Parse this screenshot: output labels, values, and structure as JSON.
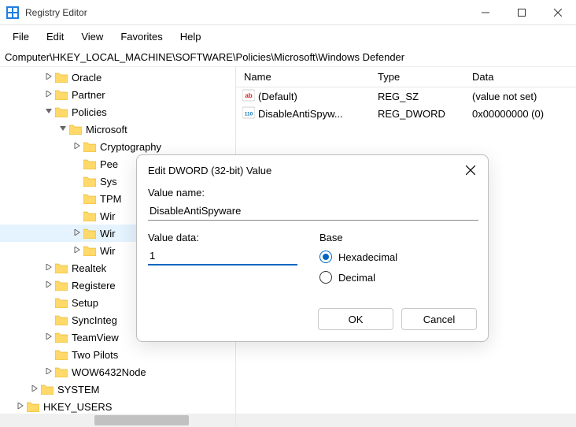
{
  "window": {
    "title": "Registry Editor"
  },
  "menu": [
    "File",
    "Edit",
    "View",
    "Favorites",
    "Help"
  ],
  "path": "Computer\\HKEY_LOCAL_MACHINE\\SOFTWARE\\Policies\\Microsoft\\Windows Defender",
  "tree": [
    {
      "indent": 3,
      "expander": "right",
      "label": "Oracle"
    },
    {
      "indent": 3,
      "expander": "right",
      "label": "Partner"
    },
    {
      "indent": 3,
      "expander": "down",
      "label": "Policies"
    },
    {
      "indent": 4,
      "expander": "down",
      "label": "Microsoft"
    },
    {
      "indent": 5,
      "expander": "right",
      "label": "Cryptography"
    },
    {
      "indent": 5,
      "expander": "none",
      "label": "Pee"
    },
    {
      "indent": 5,
      "expander": "none",
      "label": "Sys"
    },
    {
      "indent": 5,
      "expander": "none",
      "label": "TPM"
    },
    {
      "indent": 5,
      "expander": "none",
      "label": "Wir"
    },
    {
      "indent": 5,
      "expander": "right",
      "label": "Wir",
      "selected": true
    },
    {
      "indent": 5,
      "expander": "right",
      "label": "Wir"
    },
    {
      "indent": 3,
      "expander": "right",
      "label": "Realtek"
    },
    {
      "indent": 3,
      "expander": "right",
      "label": "Registere"
    },
    {
      "indent": 3,
      "expander": "none",
      "label": "Setup"
    },
    {
      "indent": 3,
      "expander": "none",
      "label": "SyncInteg"
    },
    {
      "indent": 3,
      "expander": "right",
      "label": "TeamView"
    },
    {
      "indent": 3,
      "expander": "none",
      "label": "Two Pilots"
    },
    {
      "indent": 3,
      "expander": "right",
      "label": "WOW6432Node"
    },
    {
      "indent": 2,
      "expander": "right",
      "label": "SYSTEM"
    },
    {
      "indent": 1,
      "expander": "right",
      "label": "HKEY_USERS"
    }
  ],
  "list": {
    "columns": {
      "name": "Name",
      "type": "Type",
      "data": "Data"
    },
    "rows": [
      {
        "icon": "sz",
        "name": "(Default)",
        "type": "REG_SZ",
        "data": "(value not set)"
      },
      {
        "icon": "bin",
        "name": "DisableAntiSpyw...",
        "type": "REG_DWORD",
        "data": "0x00000000 (0)"
      }
    ]
  },
  "dialog": {
    "title": "Edit DWORD (32-bit) Value",
    "value_name_label": "Value name:",
    "value_name": "DisableAntiSpyware",
    "value_data_label": "Value data:",
    "value_data": "1",
    "base_label": "Base",
    "radio_hex": "Hexadecimal",
    "radio_dec": "Decimal",
    "radio_selected": "hex",
    "ok": "OK",
    "cancel": "Cancel"
  }
}
